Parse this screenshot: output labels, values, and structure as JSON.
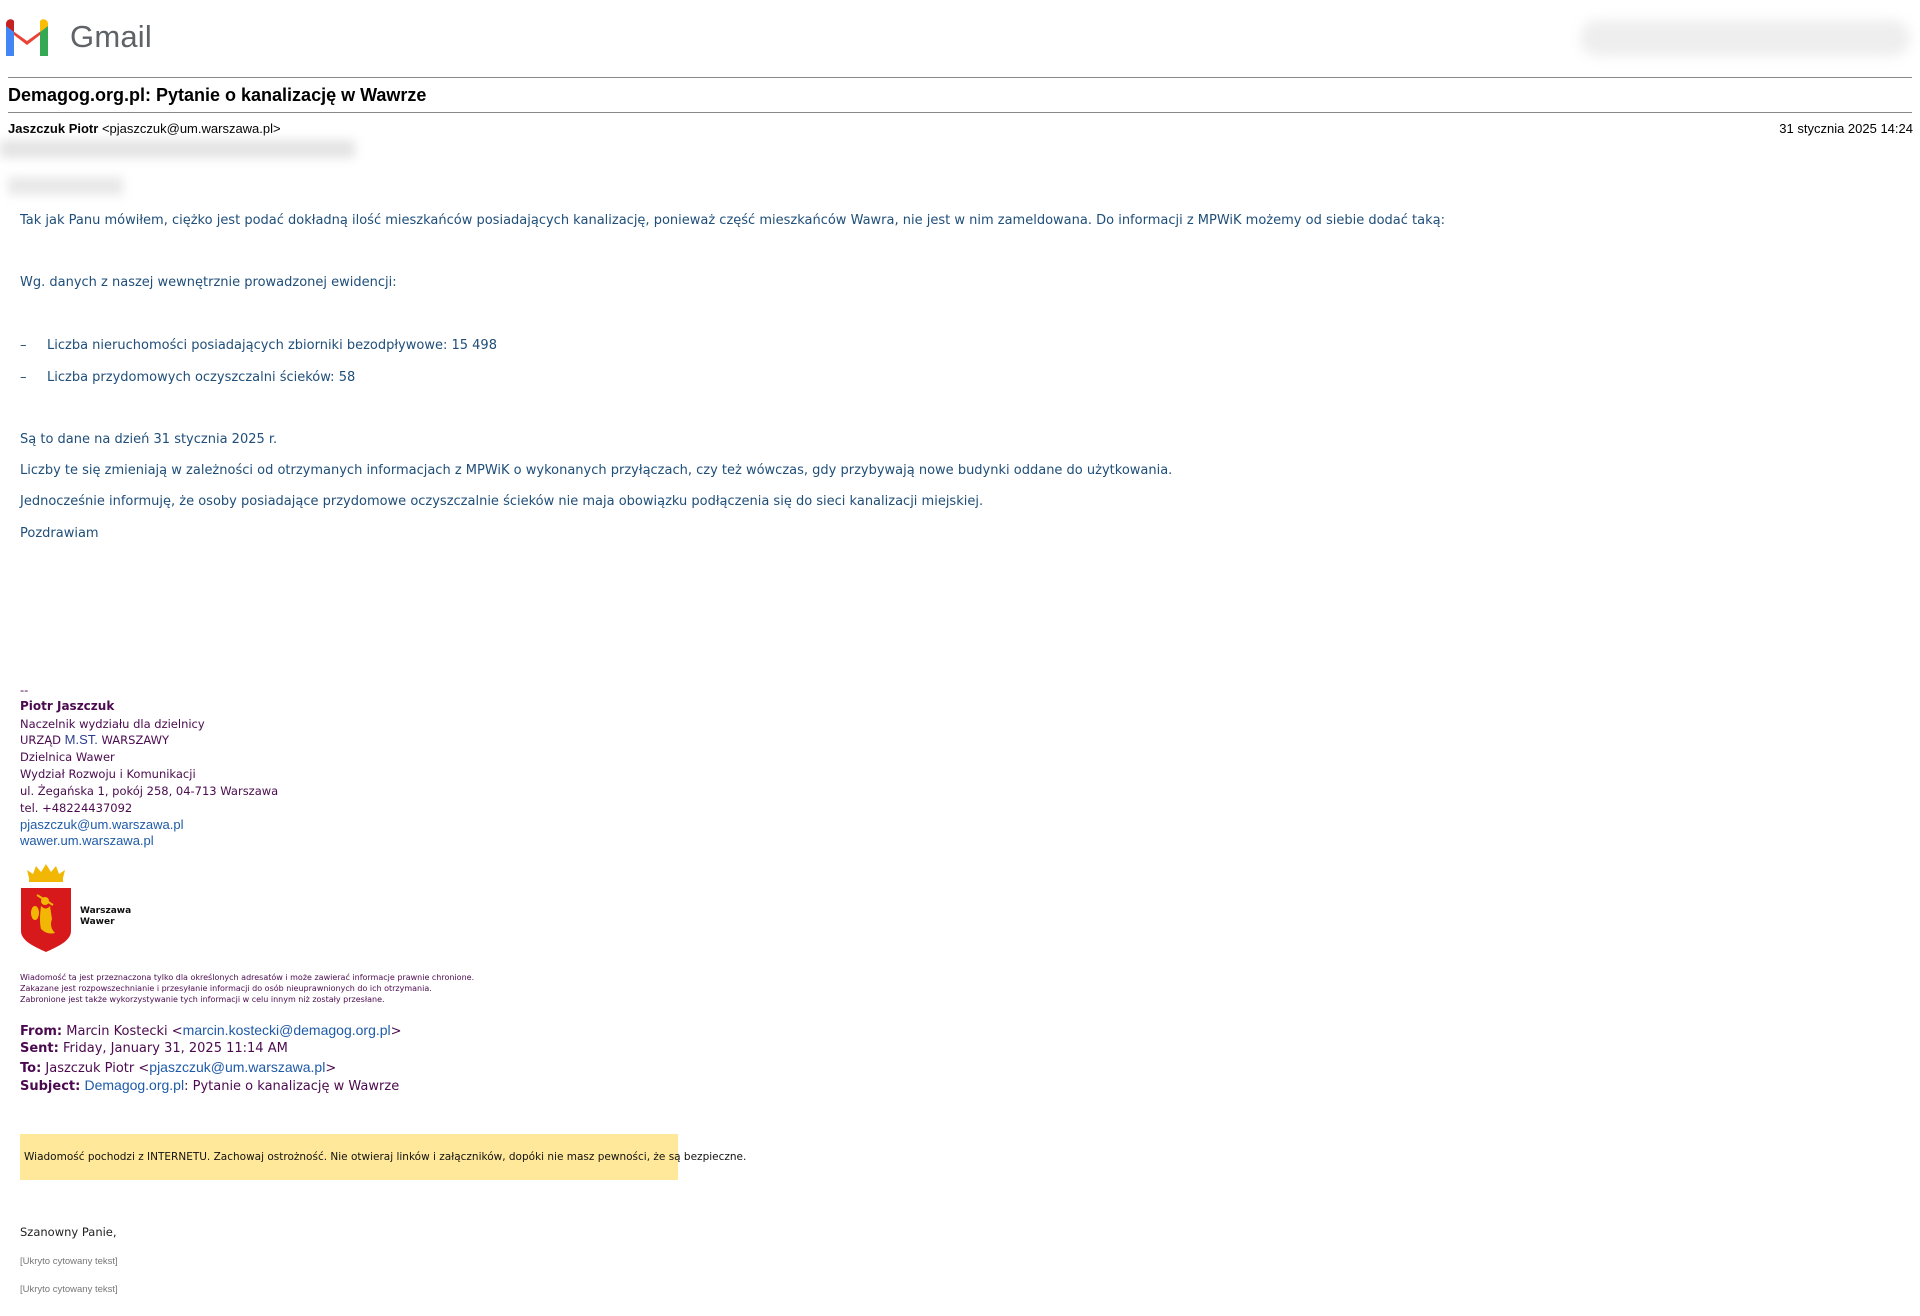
{
  "app": {
    "name": "Gmail"
  },
  "message": {
    "subject": "Demagog.org.pl: Pytanie o kanalizację w Wawrze",
    "sender_name": "Jaszczuk Piotr",
    "sender_email": "<pjaszczuk@um.warszawa.pl>",
    "date": "31 stycznia 2025 14:24"
  },
  "body": {
    "p1": "Tak jak Panu mówiłem, ciężko jest podać dokładną ilość mieszkańców posiadających kanalizację, ponieważ część mieszkańców Wawra, nie jest w nim zameldowana. Do informacji z MPWiK możemy od siebie dodać taką:",
    "p2": "Wg. danych z naszej wewnętrznie prowadzonej ewidencji:",
    "bullet_dash": "–",
    "b1": "Liczba nieruchomości posiadających zbiorniki bezodpływowe: 15 498",
    "b2": "Liczba przydomowych oczyszczalni ścieków: 58",
    "p3": "Są to dane na dzień 31 stycznia 2025 r.",
    "p4": "Liczby te się zmieniają w zależności od otrzymanych informacjach z MPWiK o wykonanych przyłączach, czy też wówczas, gdy przybywają nowe budynki oddane do użytkowania.",
    "p5": "Jednocześnie informuję, że osoby posiadające przydomowe oczyszczalnie ścieków nie maja obowiązku podłączenia się do sieci kanalizacji miejskiej.",
    "p6": "Pozdrawiam"
  },
  "signature": {
    "sep": "--",
    "name": "Piotr Jaszczuk",
    "title": "Naczelnik wydziału dla dzielnicy",
    "office_a": "URZĄD ",
    "office_b": "M.ST.",
    "office_c": " WARSZAWY",
    "district": "Dzielnica Wawer",
    "department": "Wydział Rozwoju i Komunikacji",
    "address": "ul. Żegańska 1, pokój 258, 04-713 Warszawa",
    "phone": "tel. +48224437092",
    "email": "pjaszczuk@um.warszawa.pl",
    "web": "wawer.um.warszawa.pl",
    "logo_line1": "Warszawa",
    "logo_line2": "Wawer"
  },
  "disclaimer": {
    "l1": "Wiadomość ta jest przeznaczona tylko dla określonych adresatów i może zawierać informacje prawnie chronione.",
    "l2": "Zakazane jest rozpowszechnianie i przesyłanie informacji do osób nieuprawnionych do ich otrzymania.",
    "l3": "Zabronione jest także wykorzystywanie tych informacji w celu innym niż zostały przesłane."
  },
  "forwarded": {
    "from_label": "From:",
    "from_name": " Marcin Kostecki <",
    "from_email": "marcin.kostecki@demagog.org.pl",
    "from_close": ">",
    "sent_label": "Sent:",
    "sent_value": " Friday, January 31, 2025 11:14 AM",
    "to_label": "To:",
    "to_name": " Jaszczuk Piotr <",
    "to_email": "pjaszczuk@um.warszawa.pl",
    "to_close": ">",
    "subject_label": "Subject:",
    "subject_link": "Demagog.org.pl",
    "subject_rest": ": Pytanie o kanalizację w Wawrze",
    "warning": "Wiadomość pochodzi z INTERNETU. Zachowaj ostrożność. Nie otwieraj linków i załączników, dopóki nie masz pewności, że są bezpieczne.",
    "greeting": "Szanowny Panie,",
    "hidden1": "[Ukryto cytowany tekst]",
    "hidden2": "[Ukryto cytowany tekst]"
  }
}
